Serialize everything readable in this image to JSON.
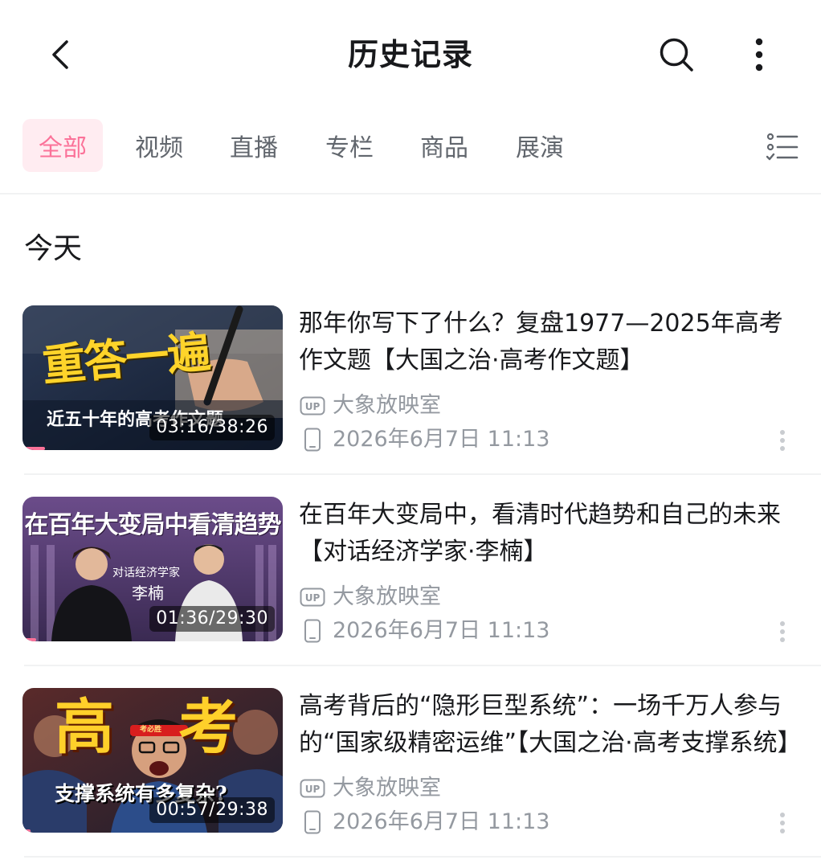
{
  "header": {
    "back_icon": "back-arrow-icon",
    "title": "历史记录",
    "search_icon": "search-icon",
    "more_icon": "more-vertical-icon"
  },
  "tabs": [
    {
      "label": "全部",
      "active": true
    },
    {
      "label": "视频",
      "active": false
    },
    {
      "label": "直播",
      "active": false
    },
    {
      "label": "专栏",
      "active": false
    },
    {
      "label": "商品",
      "active": false
    },
    {
      "label": "展演",
      "active": false
    }
  ],
  "filter_icon": "checklist-icon",
  "section": {
    "heading": "今天"
  },
  "colors": {
    "accent": "#fb7299",
    "accent_bg": "#ffecf1",
    "meta": "#9499a0",
    "text": "#18191c"
  },
  "items": [
    {
      "title": "那年你写下了什么？复盘1977—2025年高考作文题【大国之治·高考作文题】",
      "uploader": "大象放映室",
      "uploader_badge": "UP",
      "time": "2026年6月7日 11:13",
      "duration": "03:16/38:26",
      "progress": 0.085,
      "thumb_text_main": "重答一遍",
      "thumb_text_sub": "近五十年的高考作文题"
    },
    {
      "title": "在百年大变局中，看清时代趋势和自己的未来【对话经济学家·李楠】",
      "uploader": "大象放映室",
      "uploader_badge": "UP",
      "time": "2026年6月7日 11:13",
      "duration": "01:36/29:30",
      "progress": 0.054,
      "thumb_text_main": "在百年大变局中看清趋势",
      "thumb_text_sub": "对话经济学家",
      "thumb_text_name": "李楠"
    },
    {
      "title": "高考背后的“隐形巨型系统”：一场千万人参与的“国家级精密运维”【大国之治·高考支撑系统】",
      "uploader": "大象放映室",
      "uploader_badge": "UP",
      "time": "2026年6月7日 11:13",
      "duration": "00:57/29:38",
      "progress": 0.032,
      "thumb_text_main": "高考",
      "thumb_text_sub": "支撑系统有多复杂?",
      "thumb_text_band": "考必胜"
    }
  ]
}
